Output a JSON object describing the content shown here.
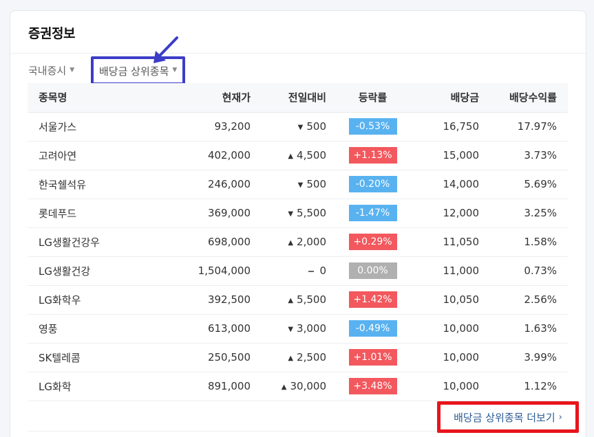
{
  "panel": {
    "title": "증권정보"
  },
  "filters": {
    "market": {
      "label": "국내증시"
    },
    "ranking": {
      "label": "배당금 상위종목"
    }
  },
  "table": {
    "headers": {
      "name": "종목명",
      "price": "현재가",
      "change": "전일대비",
      "rate": "등락률",
      "dividend": "배당금",
      "yield": "배당수익률"
    },
    "rows": [
      {
        "name": "서울가스",
        "price": "93,200",
        "direction": "down",
        "change": "500",
        "rate": "-0.53%",
        "dividend": "16,750",
        "yield": "17.97%"
      },
      {
        "name": "고려아연",
        "price": "402,000",
        "direction": "up",
        "change": "4,500",
        "rate": "+1.13%",
        "dividend": "15,000",
        "yield": "3.73%"
      },
      {
        "name": "한국쉘석유",
        "price": "246,000",
        "direction": "down",
        "change": "500",
        "rate": "-0.20%",
        "dividend": "14,000",
        "yield": "5.69%"
      },
      {
        "name": "롯데푸드",
        "price": "369,000",
        "direction": "down",
        "change": "5,500",
        "rate": "-1.47%",
        "dividend": "12,000",
        "yield": "3.25%"
      },
      {
        "name": "LG생활건강우",
        "price": "698,000",
        "direction": "up",
        "change": "2,000",
        "rate": "+0.29%",
        "dividend": "11,050",
        "yield": "1.58%"
      },
      {
        "name": "LG생활건강",
        "price": "1,504,000",
        "direction": "flat",
        "change": "0",
        "rate": "0.00%",
        "dividend": "11,000",
        "yield": "0.73%"
      },
      {
        "name": "LG화학우",
        "price": "392,500",
        "direction": "up",
        "change": "5,500",
        "rate": "+1.42%",
        "dividend": "10,050",
        "yield": "2.56%"
      },
      {
        "name": "영풍",
        "price": "613,000",
        "direction": "down",
        "change": "3,000",
        "rate": "-0.49%",
        "dividend": "10,000",
        "yield": "1.63%"
      },
      {
        "name": "SK텔레콤",
        "price": "250,500",
        "direction": "up",
        "change": "2,500",
        "rate": "+1.01%",
        "dividend": "10,000",
        "yield": "3.99%"
      },
      {
        "name": "LG화학",
        "price": "891,000",
        "direction": "up",
        "change": "30,000",
        "rate": "+3.48%",
        "dividend": "10,000",
        "yield": "1.12%"
      }
    ]
  },
  "more_link": {
    "label": "배당금 상위종목 더보기"
  },
  "icons": {
    "dropdown": "caret-down-icon",
    "up": "triangle-up-icon",
    "down": "triangle-down-icon",
    "flat": "dash-icon",
    "more": "chevron-right-icon"
  },
  "colors": {
    "up_text": "#e8454e",
    "down_text": "#3d82d8",
    "up_badge": "#f2585d",
    "down_badge": "#59b2f0",
    "flat_badge": "#b0b0b0",
    "highlight_blue": "#3c3cc8",
    "highlight_red": "#e8141c"
  }
}
